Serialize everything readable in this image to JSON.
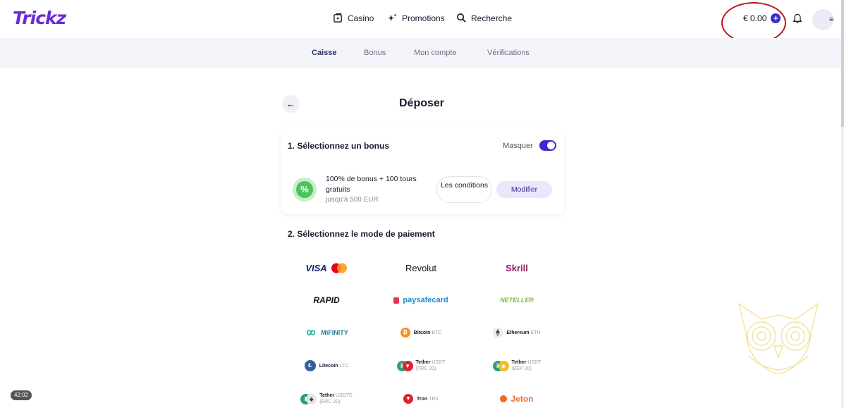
{
  "header": {
    "logo": "Trickz",
    "nav": [
      {
        "label": "Casino",
        "icon": "casino-icon"
      },
      {
        "label": "Promotions",
        "icon": "sparkle-icon"
      },
      {
        "label": "Recherche",
        "icon": "search-icon"
      }
    ],
    "balance": "€ 0.00",
    "balance_add_icon": "plus-circle-icon",
    "notification_icon": "bell-icon",
    "menu_icon": "hamburger-icon"
  },
  "subnav": {
    "tabs": [
      "Caisse",
      "Bonus",
      "Mon compte",
      "Vérifications"
    ],
    "active": "Caisse"
  },
  "page": {
    "back_icon": "arrow-left-icon",
    "title": "Déposer"
  },
  "bonus_section": {
    "heading": "1. Sélectionnez un bonus",
    "hide_label": "Masquer",
    "hide_toggle_on": true,
    "bonus_title": "100% de bonus + 100 tours gratuits",
    "bonus_subtitle": "jusqu'à 500 EUR",
    "conditions_label": "Les conditions",
    "modify_label": "Modifier"
  },
  "payment_section": {
    "heading": "2. Sélectionnez le mode de paiement",
    "methods": [
      {
        "name": "VISA",
        "extra": ""
      },
      {
        "name": "Revolut",
        "extra": ""
      },
      {
        "name": "Skrill",
        "extra": ""
      },
      {
        "name": "RAPID",
        "extra": ""
      },
      {
        "name": "paysafecard",
        "extra": ""
      },
      {
        "name": "NETELLER",
        "extra": ""
      },
      {
        "name": "MiFINITY",
        "extra": ""
      },
      {
        "name": "Bitcoin",
        "extra": "BTC"
      },
      {
        "name": "Ethereum",
        "extra": "ETH"
      },
      {
        "name": "Litecoin",
        "extra": "LTC"
      },
      {
        "name": "Tether",
        "extra": "USDT",
        "network": "(TRC 20)"
      },
      {
        "name": "Tether",
        "extra": "USDT",
        "network": "(BEP 20)"
      },
      {
        "name": "Tether",
        "extra": "USDTE",
        "network": "(ERC 20)"
      },
      {
        "name": "Tron",
        "extra": "TRX"
      },
      {
        "name": "Jeton",
        "extra": ""
      }
    ]
  },
  "timestamp_badge": "42:02",
  "colors": {
    "brand": "#6a2bd9",
    "accent": "#3b2ac9",
    "highlight_ring": "#c0141c"
  }
}
